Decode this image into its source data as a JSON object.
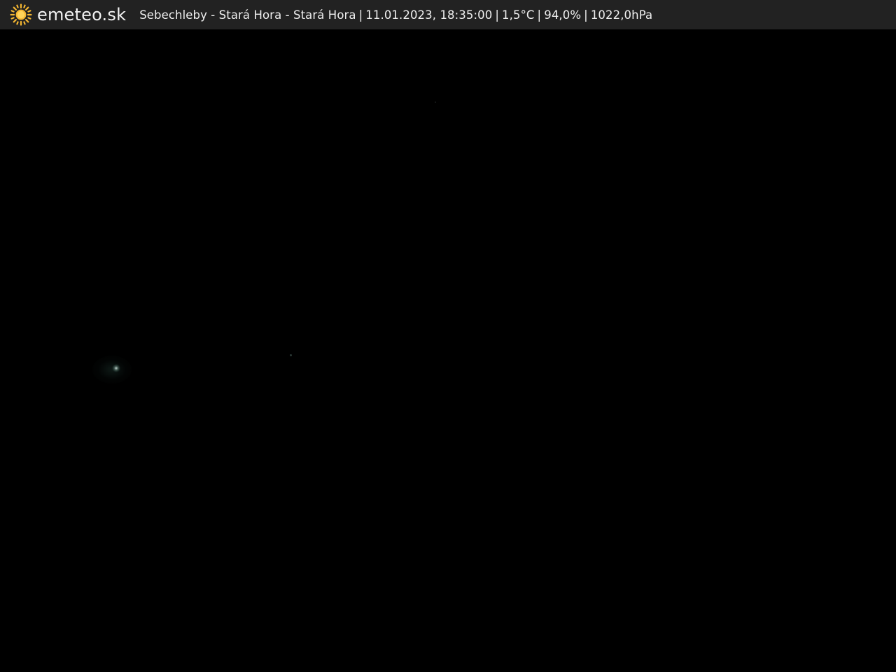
{
  "header": {
    "brand": "emeteo.sk",
    "logo_icon": "sun-icon",
    "logo_color": "#f5b731",
    "station": "Sebechleby - Stará Hora - Stará Hora",
    "datetime": "11.01.2023, 18:35:00",
    "temperature": "1,5°C",
    "humidity": "94,0%",
    "pressure": "1022,0hPa",
    "separator": "|"
  },
  "scene": {
    "description_colors": {
      "bar_background": "#222222",
      "image_background": "#000000"
    }
  }
}
